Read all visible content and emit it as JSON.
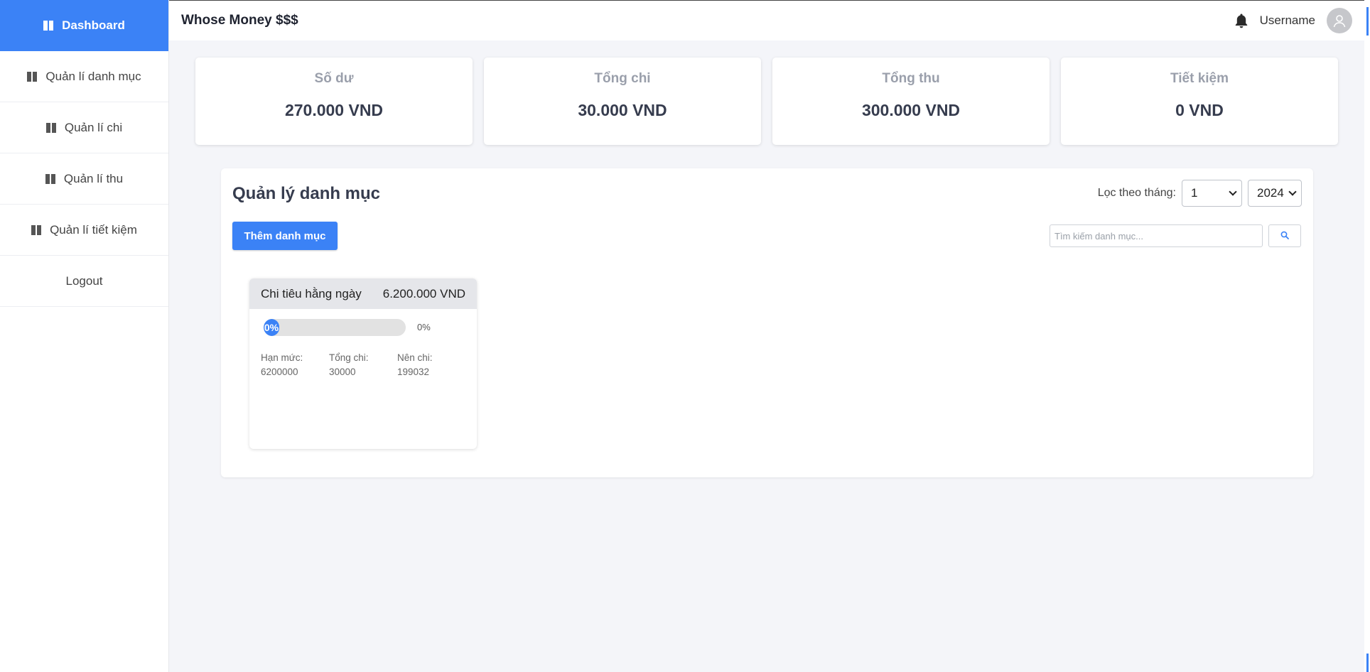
{
  "sidebar": {
    "items": [
      {
        "label": "Dashboard",
        "icon": "dashboard-icon",
        "active": true
      },
      {
        "label": "Quản lí danh mục",
        "icon": "dashboard-icon"
      },
      {
        "label": "Quản lí chi",
        "icon": "dashboard-icon"
      },
      {
        "label": "Quản lí thu",
        "icon": "dashboard-icon"
      },
      {
        "label": "Quản lí tiết kiệm",
        "icon": "dashboard-icon"
      },
      {
        "label": "Logout"
      }
    ]
  },
  "header": {
    "title": "Whose Money $$$",
    "username": "Username",
    "icons": [
      "bell-icon",
      "avatar-icon"
    ]
  },
  "stats": [
    {
      "label": "Số dư",
      "value": "270.000 VND"
    },
    {
      "label": "Tổng chi",
      "value": "30.000 VND"
    },
    {
      "label": "Tổng thu",
      "value": "300.000 VND"
    },
    {
      "label": "Tiết kiệm",
      "value": "0 VND"
    }
  ],
  "panel": {
    "title": "Quản lý danh mục",
    "filter_label": "Lọc theo tháng:",
    "month": "1",
    "year": "2024",
    "add_button": "Thêm danh mục",
    "search_placeholder": "Tìm kiếm danh mục...",
    "search_icon": "search-icon"
  },
  "categories": [
    {
      "name": "Chi tiêu hằng ngày",
      "amount": "6.200.000 VND",
      "progress": 0,
      "progress_label": "0%",
      "progress_right": "0%",
      "limit": "Hạn mức: 6200000",
      "spent": "Tổng chi: 30000",
      "should_spend": "Nên chi: 199032"
    }
  ],
  "colors": {
    "accent": "#3b82f6",
    "background": "#f4f5f9",
    "card": "#ffffff",
    "card_header": "#e5e6ea"
  }
}
